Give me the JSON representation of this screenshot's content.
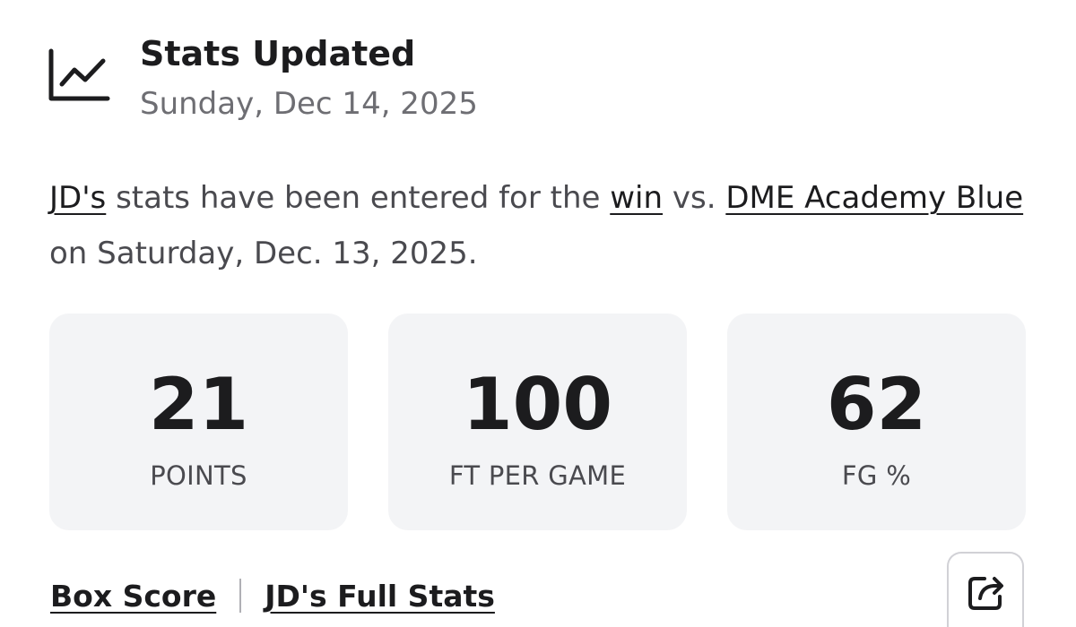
{
  "header": {
    "icon": "line-chart-icon",
    "title": "Stats Updated",
    "date": "Sunday, Dec 14, 2025"
  },
  "message": {
    "player_link": "JD's",
    "text_1": " stats have been entered for the ",
    "result_link": "win",
    "text_2": " vs. ",
    "opponent_link": "DME Academy Blue",
    "text_3": " on Saturday, Dec. 13, 2025."
  },
  "stats": [
    {
      "value": "21",
      "label": "POINTS"
    },
    {
      "value": "100",
      "label": "FT PER GAME"
    },
    {
      "value": "62",
      "label": "FG %"
    }
  ],
  "footer": {
    "box_score_label": "Box Score",
    "full_stats_label": "JD's Full Stats",
    "share_icon": "share-icon"
  },
  "colors": {
    "text_primary": "#1c1c1e",
    "text_secondary": "#6e6e73",
    "card_background": "#f3f4f6"
  }
}
